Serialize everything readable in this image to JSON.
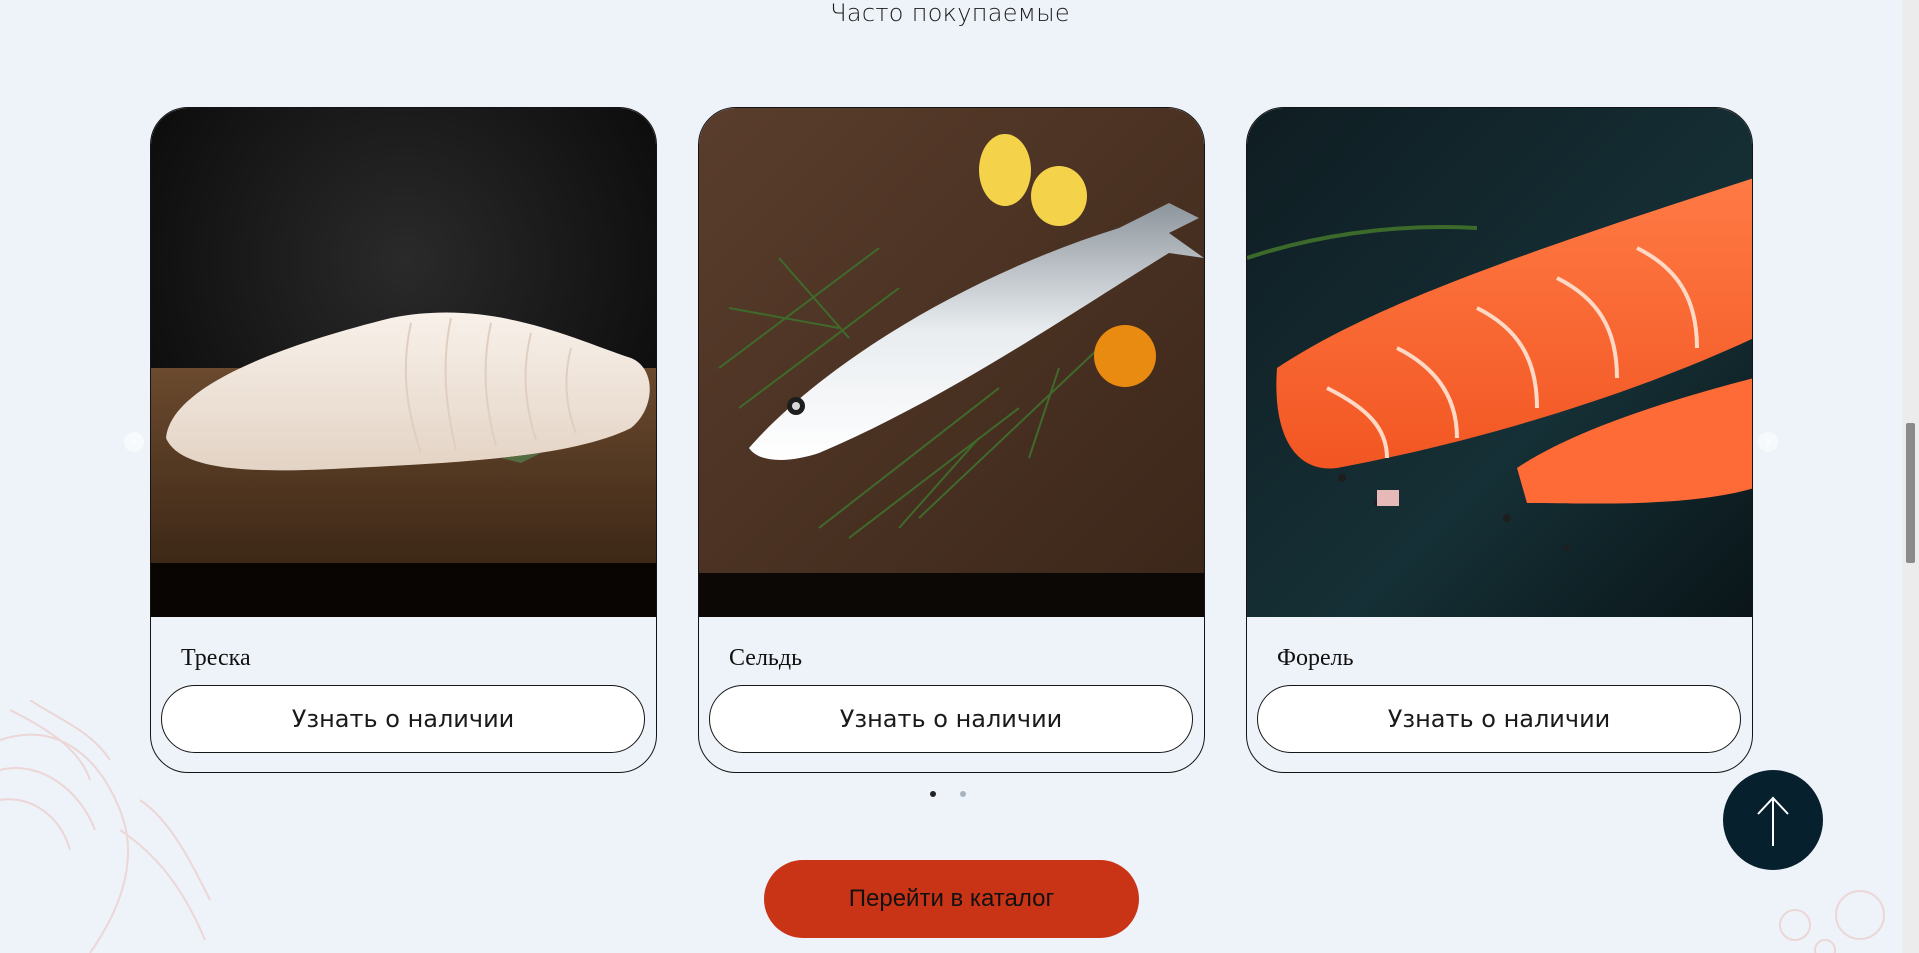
{
  "section": {
    "title": "Часто покупаемые"
  },
  "products": [
    {
      "name": "Треска",
      "button_label": "Узнать о наличии",
      "image_icon": "cod-fillet-photo"
    },
    {
      "name": "Сельдь",
      "button_label": "Узнать о наличии",
      "image_icon": "herring-photo"
    },
    {
      "name": "Форель",
      "button_label": "Узнать о наличии",
      "image_icon": "trout-fillet-photo"
    }
  ],
  "carousel": {
    "prev_icon": "chevron-left-icon",
    "next_icon": "chevron-right-icon",
    "pages": 2,
    "active_page": 1
  },
  "catalog_button": {
    "label": "Перейти в каталог"
  },
  "scroll_top_button": {
    "icon": "arrow-up-icon"
  },
  "colors": {
    "background": "#edf3f9",
    "accent": "#c93416",
    "dark": "#07202e",
    "dot_active": "#222222",
    "dot_inactive": "#a9b3bf"
  }
}
